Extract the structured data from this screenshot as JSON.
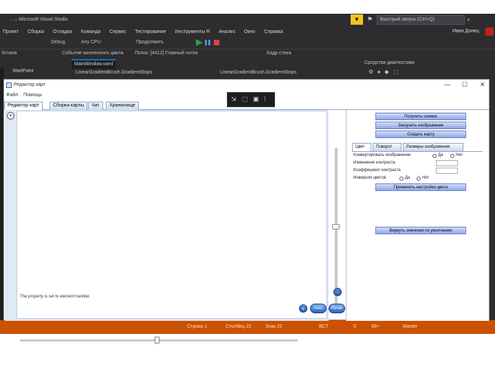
{
  "vs": {
    "title": "... – Microsoft Visual Studio",
    "search_placeholder": "Быстрый запуск (Ctrl+Q)",
    "menu": [
      "Проект",
      "Сборка",
      "Отладка",
      "Команда",
      "Сервис",
      "Тестирование",
      "Инструменты R",
      "Анализ",
      "Окно",
      "Справка"
    ],
    "user": "Иван Донец",
    "toolbar_mode": "Debug",
    "toolbar_platform": "Any CPU",
    "toolbar_continue": "Продолжить",
    "toolbar_event": "Событие жизненного цикла",
    "toolbar_thread": "Поток: [4412] Главный поток",
    "toolbar_frame": "Кадр стека",
    "left_label": "Устана",
    "doc_tabs": [
      "StartPoint",
      "MainWindow.xaml"
    ],
    "nav_left": "LinearGradientBrush.GradientStops",
    "nav_right": "LinearGradientBrush.GradientStops",
    "solution": "Средства диагностики",
    "status": [
      "Строка 1",
      "Столбец 22",
      "Знак 22",
      "ВСТ",
      "0",
      "99+",
      "Master"
    ],
    "status_color": "#ca5100"
  },
  "app": {
    "title": "Редактор карт",
    "menu": [
      "Файл",
      "Помощь"
    ],
    "tabs": [
      "Редактор карт",
      "Сборка карты",
      "Чат",
      "Хранилище"
    ],
    "map_status": "The property is set to element handler.",
    "auto_label": "Auto",
    "reset_label": "Reset",
    "panel": {
      "btn_load": "Получить снимок",
      "btn_save": "Загрузить изображение",
      "btn_create": "Создать карту",
      "tabs": [
        "Цвет",
        "Поворот",
        "Размеры изображения"
      ],
      "row1": "Конвертировать изображение",
      "row2": "Изменение контраста",
      "row3": "Коэффициент контраста",
      "row4": "Инверсия цветов",
      "yes": "Да",
      "no": "Нет",
      "btn_apply": "Применить настройки цвета",
      "btn_default": "Вернуть значения по умолчанию"
    }
  }
}
